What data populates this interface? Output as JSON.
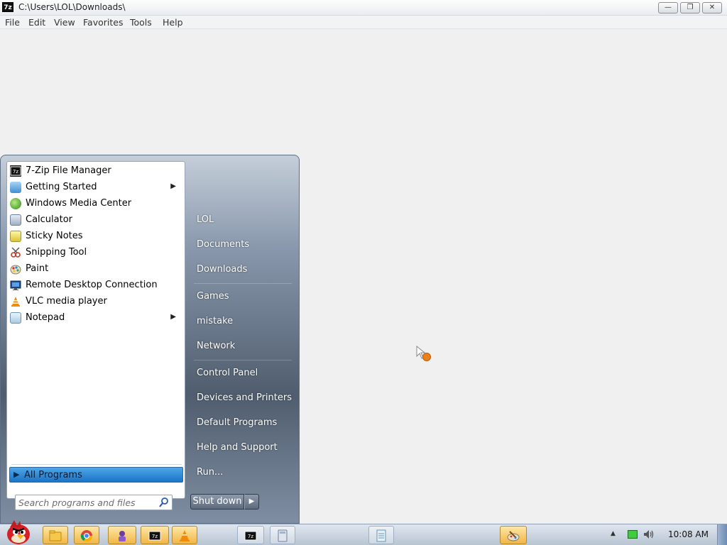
{
  "window": {
    "title": "C:\\Users\\LOL\\Downloads\\",
    "app_icon_text": "7z",
    "minimize_glyph": "—",
    "maximize_glyph": "❐",
    "close_glyph": "✕"
  },
  "menu": [
    "File",
    "Edit",
    "View",
    "Favorites",
    "Tools",
    "Help"
  ],
  "start_menu": {
    "programs": [
      {
        "label": "7-Zip File Manager",
        "icon": "7zip-icon",
        "has_submenu": false
      },
      {
        "label": "Getting Started",
        "icon": "getting-started-icon",
        "has_submenu": true
      },
      {
        "label": "Windows Media Center",
        "icon": "media-center-icon",
        "has_submenu": false
      },
      {
        "label": "Calculator",
        "icon": "calculator-icon",
        "has_submenu": false
      },
      {
        "label": "Sticky Notes",
        "icon": "sticky-notes-icon",
        "has_submenu": false
      },
      {
        "label": "Snipping Tool",
        "icon": "snipping-tool-icon",
        "has_submenu": false
      },
      {
        "label": "Paint",
        "icon": "paint-icon",
        "has_submenu": false
      },
      {
        "label": "Remote Desktop Connection",
        "icon": "remote-desktop-icon",
        "has_submenu": false
      },
      {
        "label": "VLC media player",
        "icon": "vlc-icon",
        "has_submenu": false
      },
      {
        "label": "Notepad",
        "icon": "notepad-icon",
        "has_submenu": true
      }
    ],
    "all_programs": "All Programs",
    "search_placeholder": "Search programs and files",
    "right_items": [
      "LOL",
      "Documents",
      "Downloads",
      "Games",
      "mistake",
      "Network",
      "Control Panel",
      "Devices and Printers",
      "Default Programs",
      "Help and Support",
      "Run..."
    ],
    "shutdown_label": "Shut down",
    "shutdown_arrow": "▶",
    "submenu_arrow": "▶"
  },
  "taskbar": {
    "pinned": [
      "explorer-icon",
      "chrome-icon",
      "games-icon",
      "7zip-icon",
      "vlc-icon"
    ],
    "running": [
      "7zip-icon",
      "calculator-icon",
      "notepad-icon",
      "paint-icon"
    ],
    "clock": "10:08 AM",
    "tray_arrow": "▲"
  },
  "colors": {
    "taskbar_active": "#f2b545",
    "all_programs_highlight": "#1a73c6",
    "start_menu_right": "#4f5d6e"
  }
}
